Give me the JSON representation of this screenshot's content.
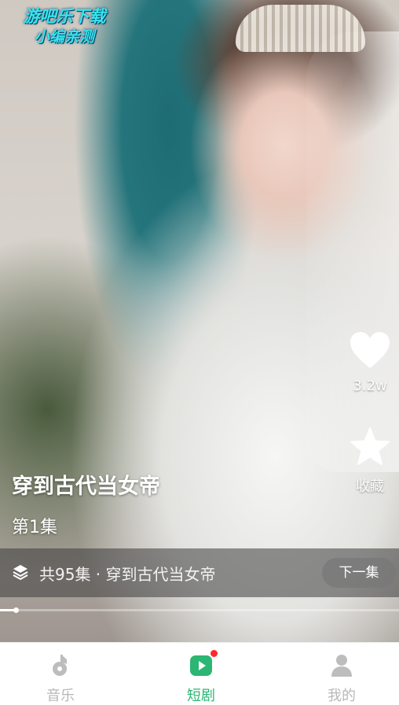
{
  "watermark": {
    "line1": "游吧乐下载",
    "line2": "小编亲测"
  },
  "video": {
    "like": {
      "icon": "heart-icon",
      "count": "3.2w"
    },
    "favorite": {
      "icon": "star-icon",
      "label": "收藏"
    },
    "drama_title": "穿到古代当女帝",
    "episode": "第1集",
    "collection_bar": {
      "icon": "layers-icon",
      "info": "共95集 · 穿到古代当女帝",
      "next_button": "下一集"
    },
    "progress": 0.04
  },
  "tabbar": {
    "items": [
      {
        "label": "音乐",
        "icon": "music-note-icon",
        "active": false
      },
      {
        "label": "短剧",
        "icon": "play-icon",
        "active": true,
        "badge_color": "#ff2a2a"
      },
      {
        "label": "我的",
        "icon": "user-icon",
        "active": false
      }
    ]
  },
  "colors": {
    "accent": "#2bb673",
    "watermark": "#37e6ef",
    "inactive": "#b8b8b8"
  }
}
